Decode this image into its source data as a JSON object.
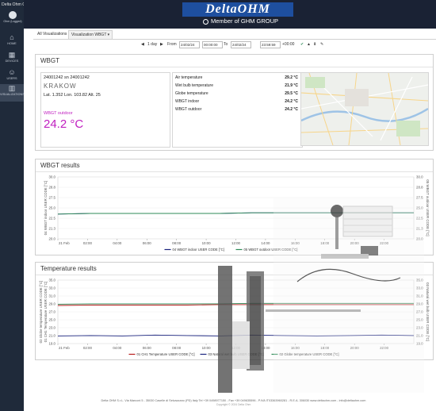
{
  "app": {
    "title": "Delta Ohm Cloud",
    "user": "Ohm (Logged)"
  },
  "sidebar": {
    "items": [
      {
        "label": "HOME",
        "icon": "home-icon"
      },
      {
        "label": "DEVICES",
        "icon": "devices-icon"
      },
      {
        "label": "USERS",
        "icon": "users-icon"
      },
      {
        "label": "VISUALIZATIONS",
        "icon": "chart-icon",
        "active": true
      }
    ]
  },
  "header": {
    "logo": "DeltaOHM",
    "member": "Member of GHM GROUP"
  },
  "tabs": [
    {
      "label": "All Visualizations"
    },
    {
      "label": "Visualization WBGT ▾"
    }
  ],
  "toolbar": {
    "range": "1 day",
    "from_label": "From",
    "from_date": "24/02/24",
    "from_time": "00:00:00",
    "to_label": "To",
    "to_date": "24/02/24",
    "to_time": "23:59:59",
    "tz": "+00:00"
  },
  "wbgt": {
    "title": "WBGT",
    "station_id": "24001242 sn 24001242",
    "city": "KRAKOW",
    "location": "Lat. 1.352 Lon. 103.82 Alt. 25",
    "outdoor_label": "WBGT outdoor",
    "outdoor_value": "24.2 °C",
    "rows": [
      {
        "label": "Air temperature",
        "value": "29.2 °C"
      },
      {
        "label": "Wet bulb temperature",
        "value": "21.9 °C"
      },
      {
        "label": "Globe temperature",
        "value": "29.5 °C"
      },
      {
        "label": "WBGT indoor",
        "value": "24.2 °C"
      },
      {
        "label": "WBGT outdoor",
        "value": "24.2 °C"
      }
    ]
  },
  "wbgt_results": {
    "title": "WBGT results"
  },
  "temp_results": {
    "title": "Temperature results"
  },
  "footer": {
    "line1": "Delta OHM S.r.L. Via Marconi 5 - 35030 Caselle di Selvazzano (PD) Italy Tel +39 0498977150 - Fax +39 049635596 - P.IVA IT03363960281 - R.E.A. 306030 www.deltaohm.com - info@deltaohm.com",
    "line2": "Copyright © 2024 Delta Ohm"
  },
  "colors": {
    "sidebar": "#1f2a3a",
    "header": "#1a2234",
    "logo_blue": "#1e4f9f",
    "magenta": "#c020c0"
  },
  "chart_data": [
    {
      "type": "line",
      "title": "WBGT results",
      "x": [
        "21 Feb",
        "02:00",
        "04:00",
        "06:00",
        "08:00",
        "10:00",
        "12:00",
        "14:00",
        "16:00",
        "18:00",
        "20:00",
        "22:00"
      ],
      "ylim": [
        20.0,
        30.0
      ],
      "yticks": [
        "30.0",
        "28.8",
        "27.5",
        "25.0",
        "22.5",
        "21.3",
        "20.0"
      ],
      "ylabel_left": "04 WBGT indoor USER CODE [°C]",
      "ylabel_right": "05 WBGT outdoor USER CODE [°C]",
      "series": [
        {
          "name": "04 WBGT indoor USER CODE [°C]",
          "color": "#1a237e",
          "values": [
            24.0,
            24.1,
            24.1,
            24.1,
            24.1,
            24.1,
            24.2,
            24.2,
            24.2,
            24.2,
            24.2,
            24.2
          ]
        },
        {
          "name": "05 WBGT outdoor USER CODE [°C]",
          "color": "#2e8b57",
          "values": [
            24.0,
            24.1,
            24.1,
            24.1,
            24.1,
            24.1,
            24.2,
            24.2,
            24.2,
            24.2,
            24.2,
            24.2
          ]
        }
      ]
    },
    {
      "type": "line",
      "title": "Temperature results",
      "x": [
        "21 Feb",
        "02:00",
        "04:00",
        "06:00",
        "08:00",
        "10:00",
        "12:00",
        "14:00",
        "16:00",
        "18:00",
        "20:00",
        "22:00"
      ],
      "ylim": [
        20.0,
        35.0
      ],
      "yticks": [
        "35.0",
        "33.0",
        "31.0",
        "29.0",
        "27.0",
        "25.0",
        "23.0",
        "21.0",
        "19.0"
      ],
      "ylabel_left": "01 CH1 Temperature USER CODE [°C]",
      "ylabel_left2": "02 Globe temperature USER CODE [°C]",
      "ylabel_right": "03 Natural wet bulb USER CODE [°C]",
      "series": [
        {
          "name": "01 CH1 Temperature USER CODE [°C]",
          "color": "#b71c1c",
          "values": [
            29.0,
            29.1,
            29.1,
            29.1,
            29.1,
            29.2,
            29.2,
            29.2,
            29.2,
            29.2,
            29.2,
            29.2
          ]
        },
        {
          "name": "03 Natural wet bulb USER CODE [°C]",
          "color": "#1a237e",
          "values": [
            21.8,
            21.9,
            21.8,
            22.0,
            21.9,
            21.8,
            22.0,
            21.9,
            21.8,
            21.9,
            22.0,
            21.9
          ]
        },
        {
          "name": "02 Globe temperature USER CODE [°C]",
          "color": "#2e8b57",
          "values": [
            29.3,
            29.4,
            29.4,
            29.4,
            29.4,
            29.4,
            29.5,
            29.5,
            29.5,
            29.5,
            29.5,
            29.5
          ]
        }
      ]
    }
  ]
}
